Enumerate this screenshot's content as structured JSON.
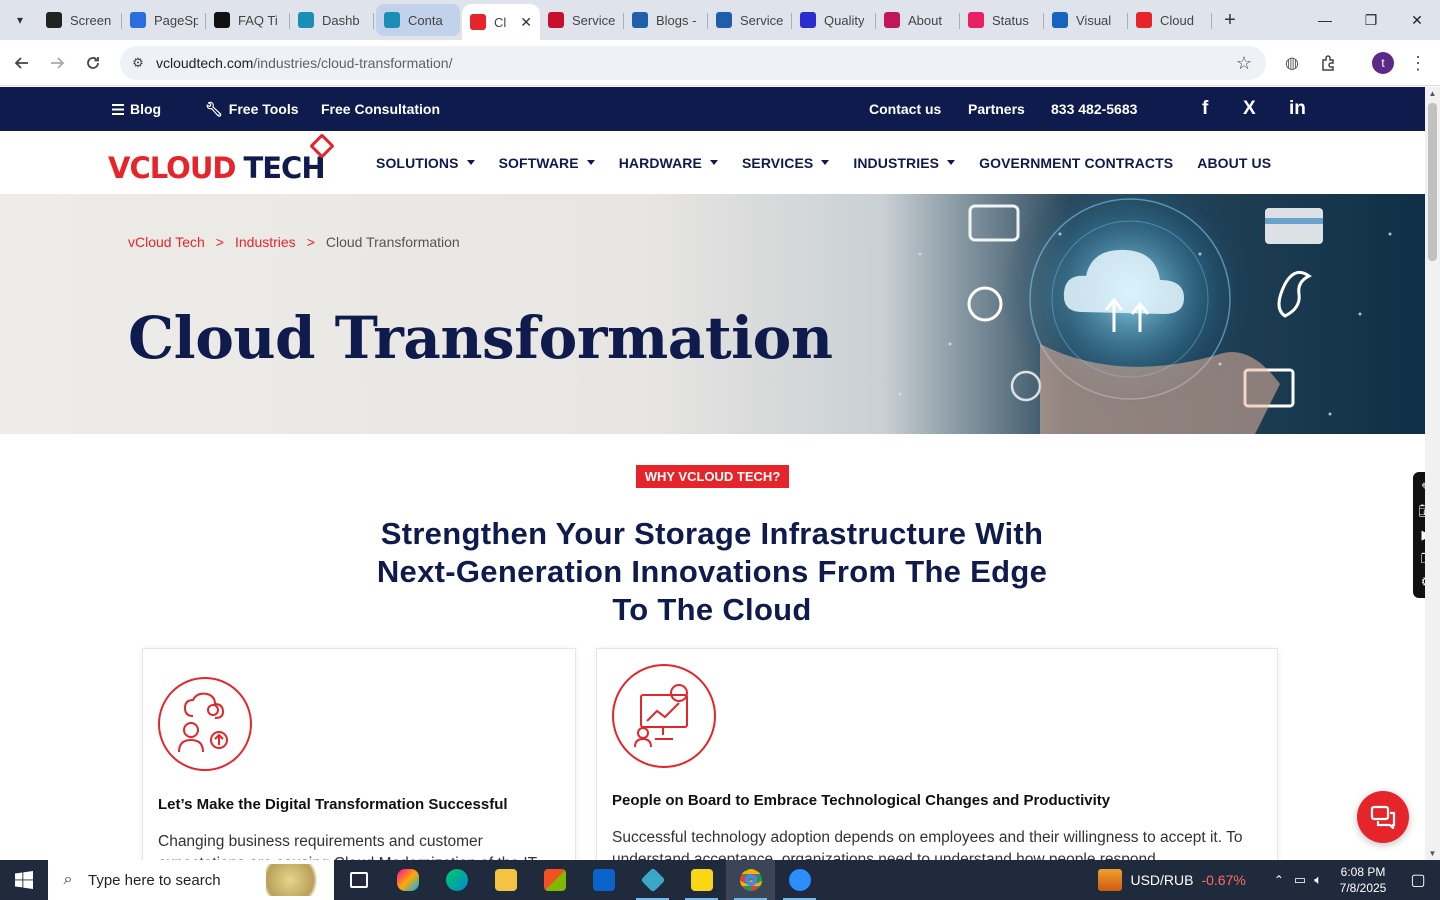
{
  "browser": {
    "tabs": [
      {
        "label": "Screen",
        "color": "#222222"
      },
      {
        "label": "PageSp",
        "color": "#2d6cdf"
      },
      {
        "label": "FAQ Ti",
        "color": "#111111"
      },
      {
        "label": "Dashb",
        "color": "#1a8fb5"
      },
      {
        "label": "Conta",
        "color": "#1a8fb5"
      },
      {
        "label": "Cl",
        "color": "#e5252a"
      },
      {
        "label": "Service",
        "color": "#c8102e"
      },
      {
        "label": "Blogs -",
        "color": "#1f5fa8"
      },
      {
        "label": "Service",
        "color": "#1f5fa8"
      },
      {
        "label": "Quality",
        "color": "#2b2bd1"
      },
      {
        "label": "About",
        "color": "#c2185b"
      },
      {
        "label": "Status",
        "color": "#e91e63"
      },
      {
        "label": "Visual",
        "color": "#1565c0"
      },
      {
        "label": "Cloud",
        "color": "#e5252a"
      }
    ],
    "active_tab_close": "✕",
    "new_tab": "+",
    "url_domain": "vcloudtech.com",
    "url_path": "/industries/cloud-transformation/",
    "profile_initial": "t"
  },
  "site": {
    "topbar": {
      "blog": "Blog",
      "free_tools": "Free Tools",
      "free_consultation": "Free Consultation",
      "contact": "Contact us",
      "partners": "Partners",
      "phone": "833 482-5683",
      "social": [
        "f",
        "X",
        "in"
      ]
    },
    "logo": {
      "v": "VCLOUD",
      "t": "TECH"
    },
    "menu": [
      {
        "label": "SOLUTIONS",
        "dropdown": true
      },
      {
        "label": "SOFTWARE",
        "dropdown": true
      },
      {
        "label": "HARDWARE",
        "dropdown": true
      },
      {
        "label": "SERVICES",
        "dropdown": true
      },
      {
        "label": "INDUSTRIES",
        "dropdown": true
      },
      {
        "label": "GOVERNMENT CONTRACTS",
        "dropdown": false
      },
      {
        "label": "ABOUT US",
        "dropdown": false
      }
    ],
    "breadcrumb": {
      "home": "vCloud Tech",
      "sep": ">",
      "section": "Industries",
      "current": "Cloud Transformation"
    },
    "hero_title": "Cloud Transformation",
    "why_badge": "WHY VCLOUD TECH?",
    "headline": "Strengthen Your Storage Infrastructure With Next-Generation Innovations From The Edge To The Cloud",
    "cards": [
      {
        "title": "Let’s Make the Digital Transformation Successful",
        "text": "Changing business requirements and customer expectations are causing Cloud Modernization of the IT"
      },
      {
        "title": "People on Board to Embrace Technological Changes and Productivity",
        "text": "Successful technology adoption depends on employees and their willingness to accept it. To understand acceptance, organizations need to understand how people respond"
      }
    ],
    "accent": "#e5252a",
    "navy": "#0f1b4c"
  },
  "taskbar": {
    "search_placeholder": "Type here to search",
    "ticker_symbol": "USD/RUB",
    "ticker_change": "-0.67%",
    "time": "6:08 PM",
    "date": "7/8/2025"
  }
}
